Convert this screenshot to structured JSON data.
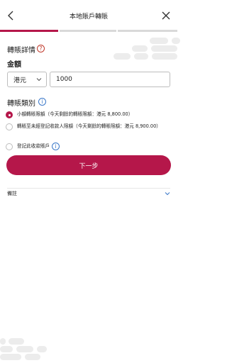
{
  "header": {
    "title": "本地賬戶轉賬",
    "back_icon": "chevron-left-icon",
    "close_icon": "close-icon"
  },
  "progress": {
    "current_step": 1,
    "total_steps": 3,
    "active_color": "#b5174a"
  },
  "transfer_details": {
    "title": "轉賬詳情",
    "help_icon": "question-mark-icon",
    "amount_label": "金額",
    "currency": "港元",
    "amount_value": "1000"
  },
  "transfer_type": {
    "title": "轉賬類別",
    "help_icon": "info-icon",
    "options": [
      {
        "label": "小額轉賬限額（今天剩餘的轉賬限額：港元 8,800.00）",
        "selected": true
      },
      {
        "label": "轉賬至未經登記收款人限額（今天剩餘的轉賬限額：港元 8,900.00）",
        "selected": false
      },
      {
        "label": "登記此收款賬戶",
        "selected": false
      }
    ]
  },
  "next_button": "下一步",
  "remark": {
    "label": "備註"
  },
  "colors": {
    "brand": "#b5174a",
    "info_blue": "#3a78c9"
  }
}
